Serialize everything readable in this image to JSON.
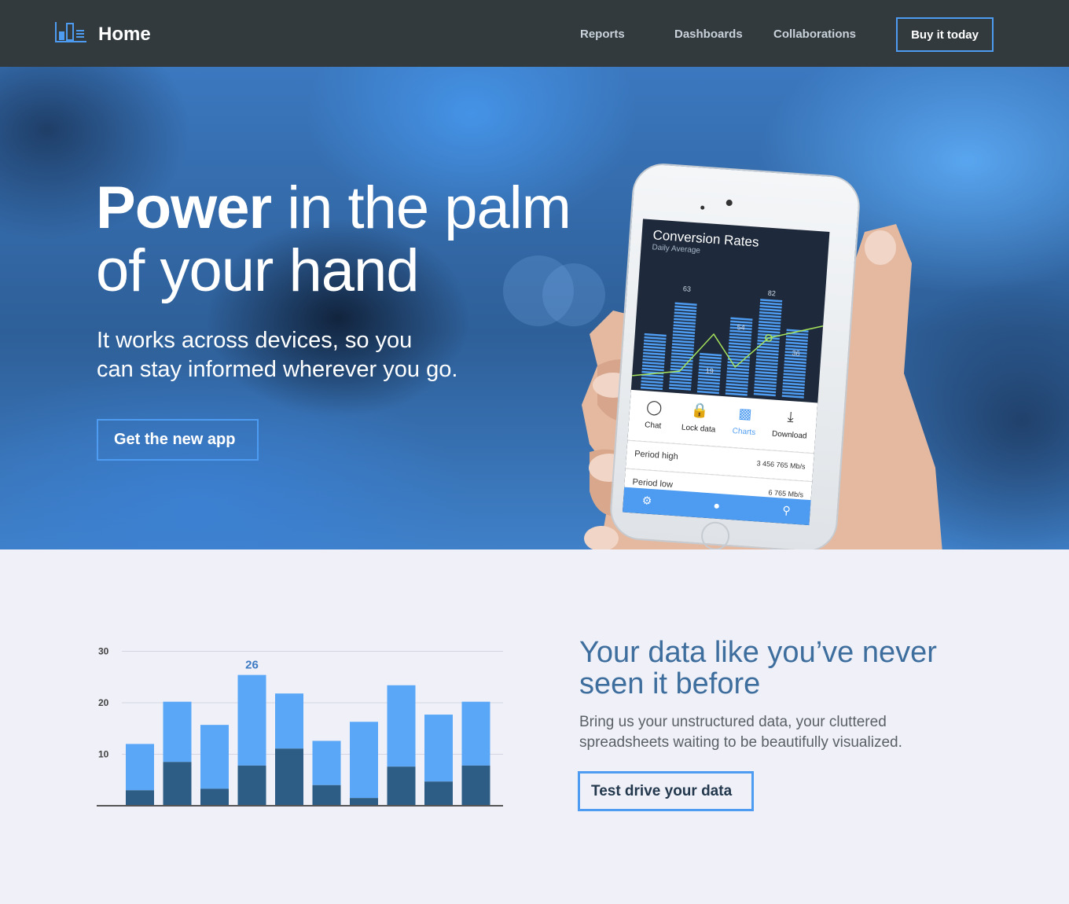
{
  "nav": {
    "brand": "Home",
    "logo_icon": "bar-chart-logo-icon",
    "links": [
      "Reports",
      "Dashboards",
      "Collaborations"
    ],
    "cta": "Buy it today"
  },
  "hero": {
    "title_bold": "Power",
    "title_rest_line1": " in the palm",
    "title_line2": "of your hand",
    "subtitle_line1": "It works across devices, so you",
    "subtitle_line2": "can stay informed wherever you go.",
    "cta": "Get the new app"
  },
  "phone": {
    "title": "Conversion Rates",
    "subtitle": "Daily Average",
    "chart_labels": [
      "63",
      "19",
      "54",
      "82",
      "36"
    ],
    "tabs": [
      {
        "label": "Chat",
        "icon": "chat-icon"
      },
      {
        "label": "Lock data",
        "icon": "lock-icon"
      },
      {
        "label": "Charts",
        "icon": "charts-icon"
      },
      {
        "label": "Download",
        "icon": "download-icon"
      }
    ],
    "rows": [
      {
        "label": "Period high",
        "value": "3 456 765 Mb/s"
      },
      {
        "label": "Period low",
        "value": "6 765 Mb/s"
      }
    ],
    "bottom_icons": [
      "gear-icon",
      "user-icon",
      "search-icon"
    ]
  },
  "feature": {
    "title": "Your data like you’ve never seen it before",
    "subtitle": "Bring us your unstructured data, your cluttered spreadsheets waiting to be beautifully visualized.",
    "cta": "Test drive your data"
  },
  "colors": {
    "accent": "#4e9cf1",
    "bar_light": "#5aa7f7",
    "bar_dark": "#2d5c85",
    "nav_bg": "#323a3d",
    "heading": "#3e6e9d"
  },
  "chart_data": {
    "type": "bar",
    "stacked": true,
    "categories": [
      "",
      "",
      "",
      "",
      "",
      "",
      "",
      "",
      "",
      ""
    ],
    "series": [
      {
        "values": [
          3,
          8.5,
          3.3,
          7.8,
          11.1,
          4,
          1.5,
          7.6,
          4.7,
          7.8
        ]
      },
      {
        "values": [
          9,
          11.7,
          12.4,
          17.6,
          10.7,
          8.6,
          14.8,
          15.8,
          13.0,
          12.4
        ]
      }
    ],
    "totals": [
      12,
      20.2,
      15.7,
      25.4,
      21.8,
      12.6,
      16.3,
      23.4,
      17.7,
      20.2
    ],
    "highlight_label": "26",
    "highlight_index": 3,
    "yticks": [
      "10",
      "20",
      "30"
    ],
    "ylim": [
      0,
      30
    ],
    "grid": true
  }
}
